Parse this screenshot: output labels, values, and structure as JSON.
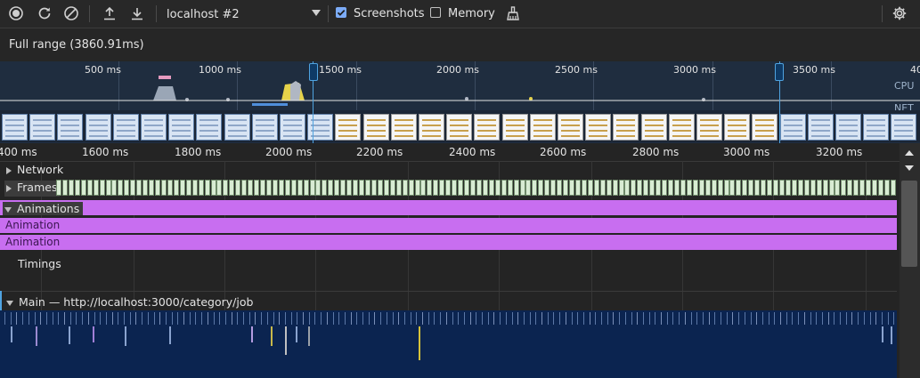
{
  "toolbar": {
    "icons": [
      "record-icon",
      "reload-icon",
      "clear-icon",
      "upload-icon",
      "download-icon",
      "settings-gear-icon",
      "clean-brush-icon"
    ],
    "session_label": "localhost #2",
    "screenshots_label": "Screenshots",
    "screenshots_checked": true,
    "memory_label": "Memory",
    "memory_checked": false
  },
  "range": {
    "label": "Full range (3860.91ms)"
  },
  "overview": {
    "ticks": [
      "500 ms",
      "1000 ms",
      "1500 ms",
      "2000 ms",
      "2500 ms",
      "3000 ms",
      "3500 ms",
      "40"
    ],
    "cpu_label": "CPU",
    "net_label": "NET"
  },
  "ruler": {
    "ticks": [
      "400 ms",
      "1600 ms",
      "1800 ms",
      "2000 ms",
      "2200 ms",
      "2400 ms",
      "2600 ms",
      "2800 ms",
      "3000 ms",
      "3200 ms"
    ]
  },
  "tracks": {
    "network": "Network",
    "frames": "Frames",
    "animations": "Animations",
    "animation_row1": "Animation",
    "animation_row2": "Animation",
    "timings": "Timings",
    "main": "Main — http://localhost:3000/category/job"
  },
  "colors": {
    "accent": "#4fa3e0",
    "animation": "#c86ef0",
    "frame": "#d8ecd3",
    "main_bg": "#0b2450"
  }
}
